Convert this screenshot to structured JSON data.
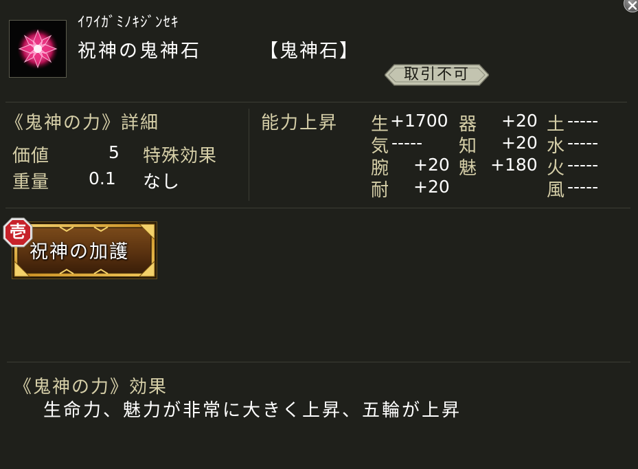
{
  "item": {
    "reading": "ｲﾜｲｶﾞﾐﾉｷｼﾞﾝｾｷ",
    "name": "祝神の鬼神石",
    "type": "【鬼神石】",
    "trade_status": "取引不可"
  },
  "details": {
    "title": "《鬼神の力》詳細",
    "value_label": "価値",
    "value": "5",
    "weight_label": "重量",
    "weight": "0.1",
    "special_label": "特殊効果",
    "special_value": "なし"
  },
  "ability": {
    "title": "能力上昇",
    "stats": [
      {
        "label": "生",
        "value": "+1700"
      },
      {
        "label": "気",
        "value": "-----"
      },
      {
        "label": "腕",
        "value": "+20"
      },
      {
        "label": "耐",
        "value": "+20"
      },
      {
        "label": "器",
        "value": "+20"
      },
      {
        "label": "知",
        "value": "+20"
      },
      {
        "label": "魅",
        "value": "+180"
      },
      {
        "label": "土",
        "value": "-----"
      },
      {
        "label": "水",
        "value": "-----"
      },
      {
        "label": "火",
        "value": "-----"
      },
      {
        "label": "風",
        "value": "-----"
      }
    ]
  },
  "skill": {
    "rank": "壱",
    "name": "祝神の加護"
  },
  "effect": {
    "title": "《鬼神の力》効果",
    "description": "生命力、魅力が非常に大きく上昇、五輪が上昇"
  },
  "colors": {
    "background": "#1f201b",
    "gold_text": "#d6cfa8",
    "badge_fill": "#c3c4b0",
    "skill_gold": "#e3b23a",
    "rank_red": "#c7222a"
  }
}
